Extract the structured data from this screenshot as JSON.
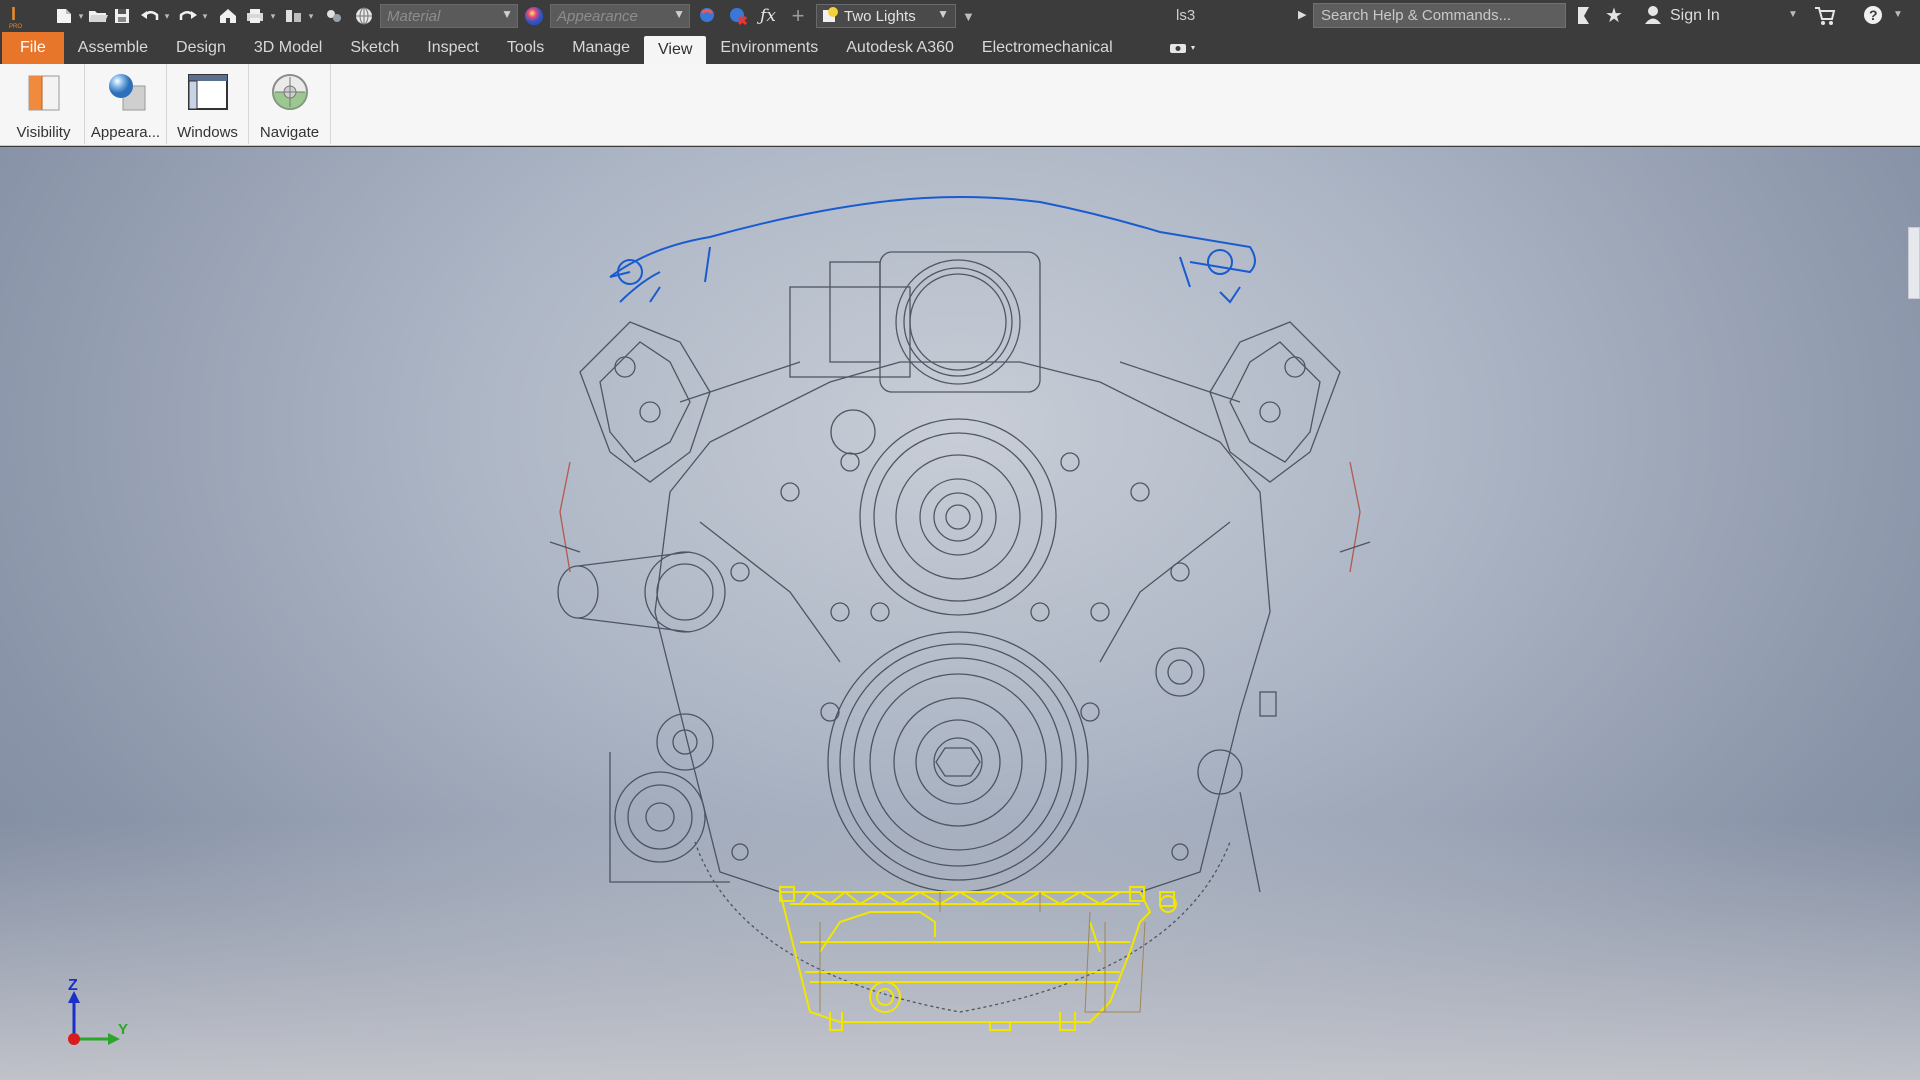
{
  "title_bar": {
    "material_placeholder": "Material",
    "appearance_placeholder": "Appearance",
    "lighting": "Two Lights",
    "document_name": "ls3",
    "search_placeholder": "Search Help & Commands...",
    "sign_in": "Sign In",
    "icons": [
      "inventor-pro-logo",
      "new-file-icon",
      "open-folder-icon",
      "save-icon",
      "undo-icon",
      "redo-icon",
      "home-icon",
      "print-icon",
      "select-icon",
      "color-icon",
      "globe-icon",
      "appearance-ball-icon",
      "adjust-icon",
      "clear-icon",
      "fx-icon",
      "plus-icon",
      "bulb-icon",
      "bookmark-icon",
      "star-icon",
      "user-icon",
      "cart-icon",
      "help-icon"
    ]
  },
  "tabs": [
    {
      "label": "File",
      "state": "file"
    },
    {
      "label": "Assemble",
      "state": "normal"
    },
    {
      "label": "Design",
      "state": "normal"
    },
    {
      "label": "3D Model",
      "state": "normal"
    },
    {
      "label": "Sketch",
      "state": "normal"
    },
    {
      "label": "Inspect",
      "state": "normal"
    },
    {
      "label": "Tools",
      "state": "normal"
    },
    {
      "label": "Manage",
      "state": "normal"
    },
    {
      "label": "View",
      "state": "active"
    },
    {
      "label": "Environments",
      "state": "normal"
    },
    {
      "label": "Autodesk A360",
      "state": "normal"
    },
    {
      "label": "Electromechanical",
      "state": "normal"
    }
  ],
  "ribbon": {
    "buttons": [
      {
        "label": "Visibility",
        "icon": "visibility-icon"
      },
      {
        "label": "Appeara...",
        "icon": "appearance-icon"
      },
      {
        "label": "Windows",
        "icon": "windows-icon"
      },
      {
        "label": "Navigate",
        "icon": "navigate-icon"
      }
    ]
  },
  "viewport": {
    "triad": {
      "z_label": "Z",
      "y_label": "Y"
    },
    "colors": {
      "highlight_yellow": "#f2e600",
      "highlight_blue": "#1a5bd0",
      "wire": "#3d4350"
    }
  }
}
